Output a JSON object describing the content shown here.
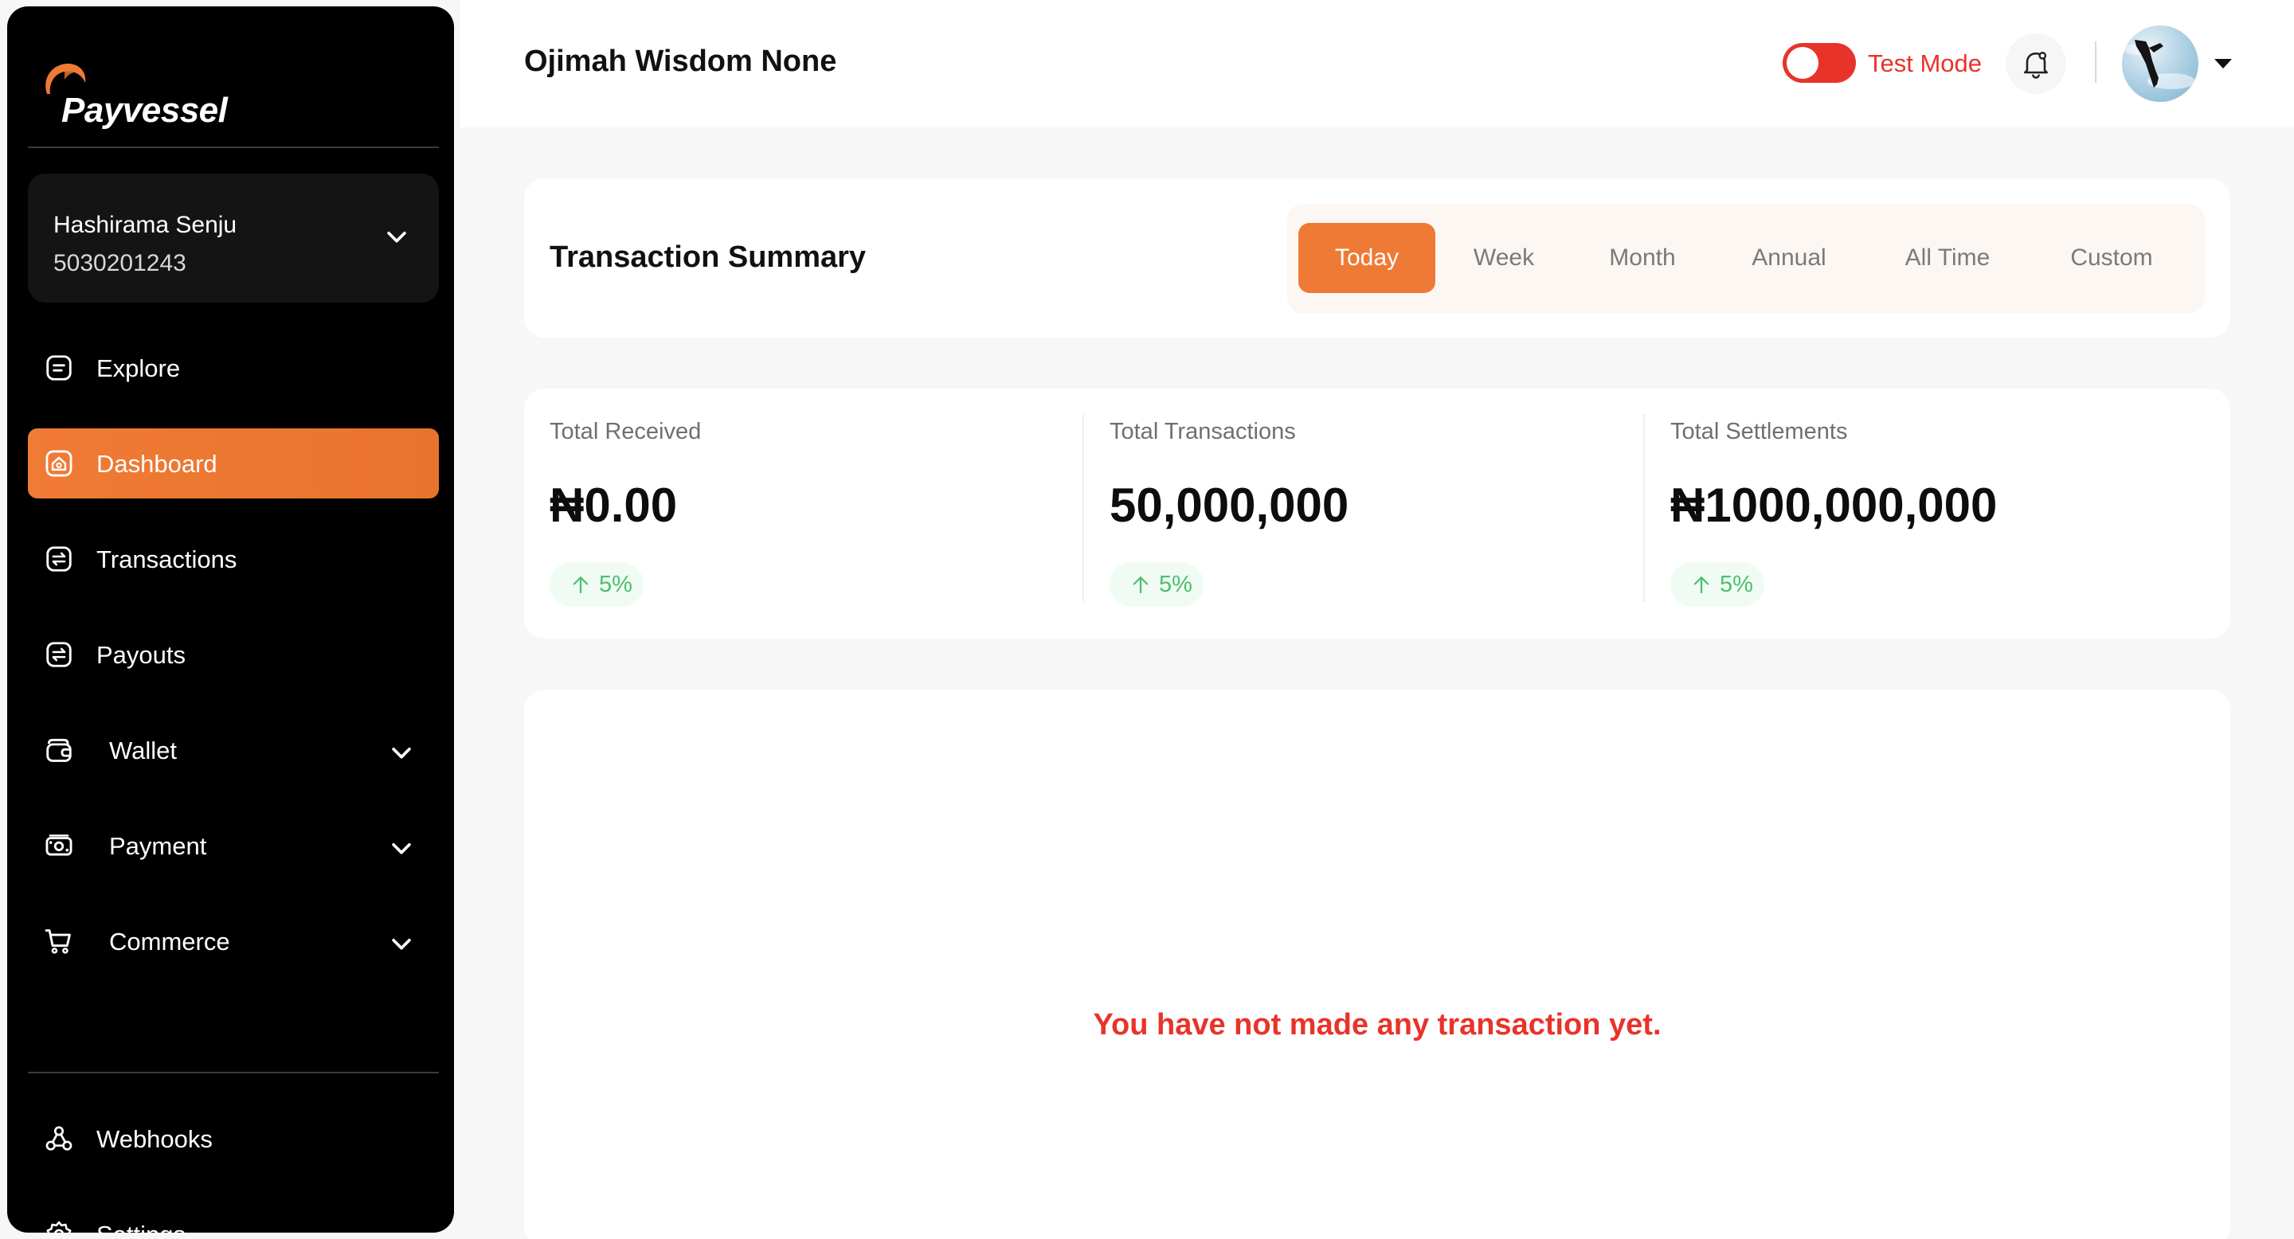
{
  "brand": {
    "name": "Payvessel",
    "accent": "#ef7a35",
    "mode_color": "#e8332a"
  },
  "sidebar": {
    "account": {
      "name": "Hashirama Senju",
      "number": "5030201243"
    },
    "items": [
      {
        "label": "Explore",
        "icon": "explore-icon",
        "active": false
      },
      {
        "label": "Dashboard",
        "icon": "home-icon",
        "active": true
      },
      {
        "label": "Transactions",
        "icon": "transactions-icon",
        "active": false
      },
      {
        "label": "Payouts",
        "icon": "payouts-icon",
        "active": false
      },
      {
        "label": "Wallet",
        "icon": "wallet-icon",
        "active": false,
        "expandable": true
      },
      {
        "label": "Payment",
        "icon": "payment-icon",
        "active": false,
        "expandable": true
      },
      {
        "label": "Commerce",
        "icon": "cart-icon",
        "active": false,
        "expandable": true
      }
    ],
    "footer_items": [
      {
        "label": "Webhooks",
        "icon": "webhook-icon"
      },
      {
        "label": "Settings",
        "icon": "settings-icon"
      }
    ]
  },
  "header": {
    "user_title": "Ojimah Wisdom None",
    "mode_label": "Test Mode",
    "test_mode_on": true
  },
  "summary": {
    "title": "Transaction Summary",
    "tabs": [
      "Today",
      "Week",
      "Month",
      "Annual",
      "All Time",
      "Custom"
    ],
    "active_tab": "Today"
  },
  "stats": [
    {
      "label": "Total Received",
      "value": "₦0.00",
      "change": "5%"
    },
    {
      "label": "Total Transactions",
      "value": "50,000,000",
      "change": "5%"
    },
    {
      "label": "Total Settlements",
      "value": "₦1000,000,000",
      "change": "5%"
    }
  ],
  "empty_state": {
    "message": "You have not made any transaction yet."
  }
}
